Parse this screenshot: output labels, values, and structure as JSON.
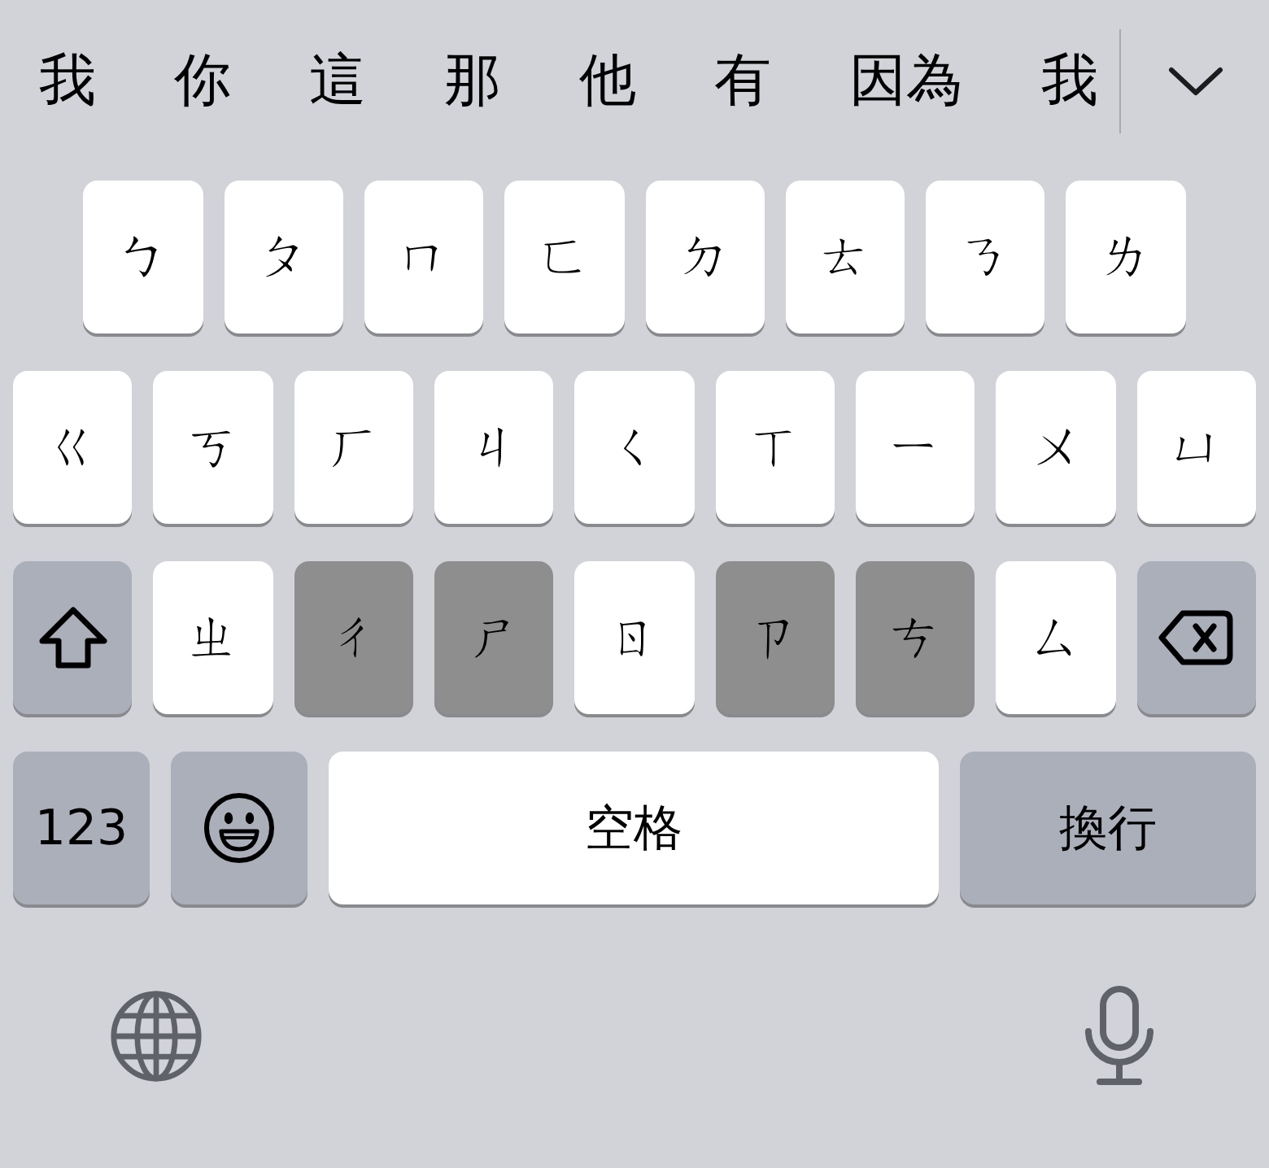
{
  "candidate_bar": {
    "candidates": [
      "我",
      "你",
      "這",
      "那",
      "他",
      "有",
      "因為",
      "我"
    ]
  },
  "keyboard": {
    "rows": [
      {
        "keys": [
          {
            "kind": "char",
            "label": "ㄅ",
            "disabled": false
          },
          {
            "kind": "char",
            "label": "ㄆ",
            "disabled": false
          },
          {
            "kind": "char",
            "label": "ㄇ",
            "disabled": false
          },
          {
            "kind": "char",
            "label": "ㄈ",
            "disabled": false
          },
          {
            "kind": "char",
            "label": "ㄉ",
            "disabled": false
          },
          {
            "kind": "char",
            "label": "ㄊ",
            "disabled": false
          },
          {
            "kind": "char",
            "label": "ㄋ",
            "disabled": false
          },
          {
            "kind": "char",
            "label": "ㄌ",
            "disabled": false
          }
        ]
      },
      {
        "keys": [
          {
            "kind": "char",
            "label": "ㄍ",
            "disabled": false
          },
          {
            "kind": "char",
            "label": "ㄎ",
            "disabled": false
          },
          {
            "kind": "char",
            "label": "ㄏ",
            "disabled": false
          },
          {
            "kind": "char",
            "label": "ㄐ",
            "disabled": false
          },
          {
            "kind": "char",
            "label": "ㄑ",
            "disabled": false
          },
          {
            "kind": "char",
            "label": "ㄒ",
            "disabled": false
          },
          {
            "kind": "char",
            "label": "ㄧ",
            "disabled": false
          },
          {
            "kind": "char",
            "label": "ㄨ",
            "disabled": false
          },
          {
            "kind": "char",
            "label": "ㄩ",
            "disabled": false
          }
        ]
      },
      {
        "keys": [
          {
            "kind": "shift",
            "disabled": false
          },
          {
            "kind": "char",
            "label": "ㄓ",
            "disabled": false
          },
          {
            "kind": "char",
            "label": "ㄔ",
            "disabled": true
          },
          {
            "kind": "char",
            "label": "ㄕ",
            "disabled": true
          },
          {
            "kind": "char",
            "label": "ㄖ",
            "disabled": false
          },
          {
            "kind": "char",
            "label": "ㄗ",
            "disabled": true
          },
          {
            "kind": "char",
            "label": "ㄘ",
            "disabled": true
          },
          {
            "kind": "char",
            "label": "ㄙ",
            "disabled": false
          },
          {
            "kind": "delete",
            "disabled": false
          }
        ]
      },
      {
        "keys": [
          {
            "kind": "mode",
            "label": "123",
            "disabled": false
          },
          {
            "kind": "emoji",
            "disabled": false
          },
          {
            "kind": "space",
            "label": "空格",
            "disabled": false
          },
          {
            "kind": "return",
            "label": "換行",
            "disabled": false
          }
        ]
      }
    ]
  }
}
